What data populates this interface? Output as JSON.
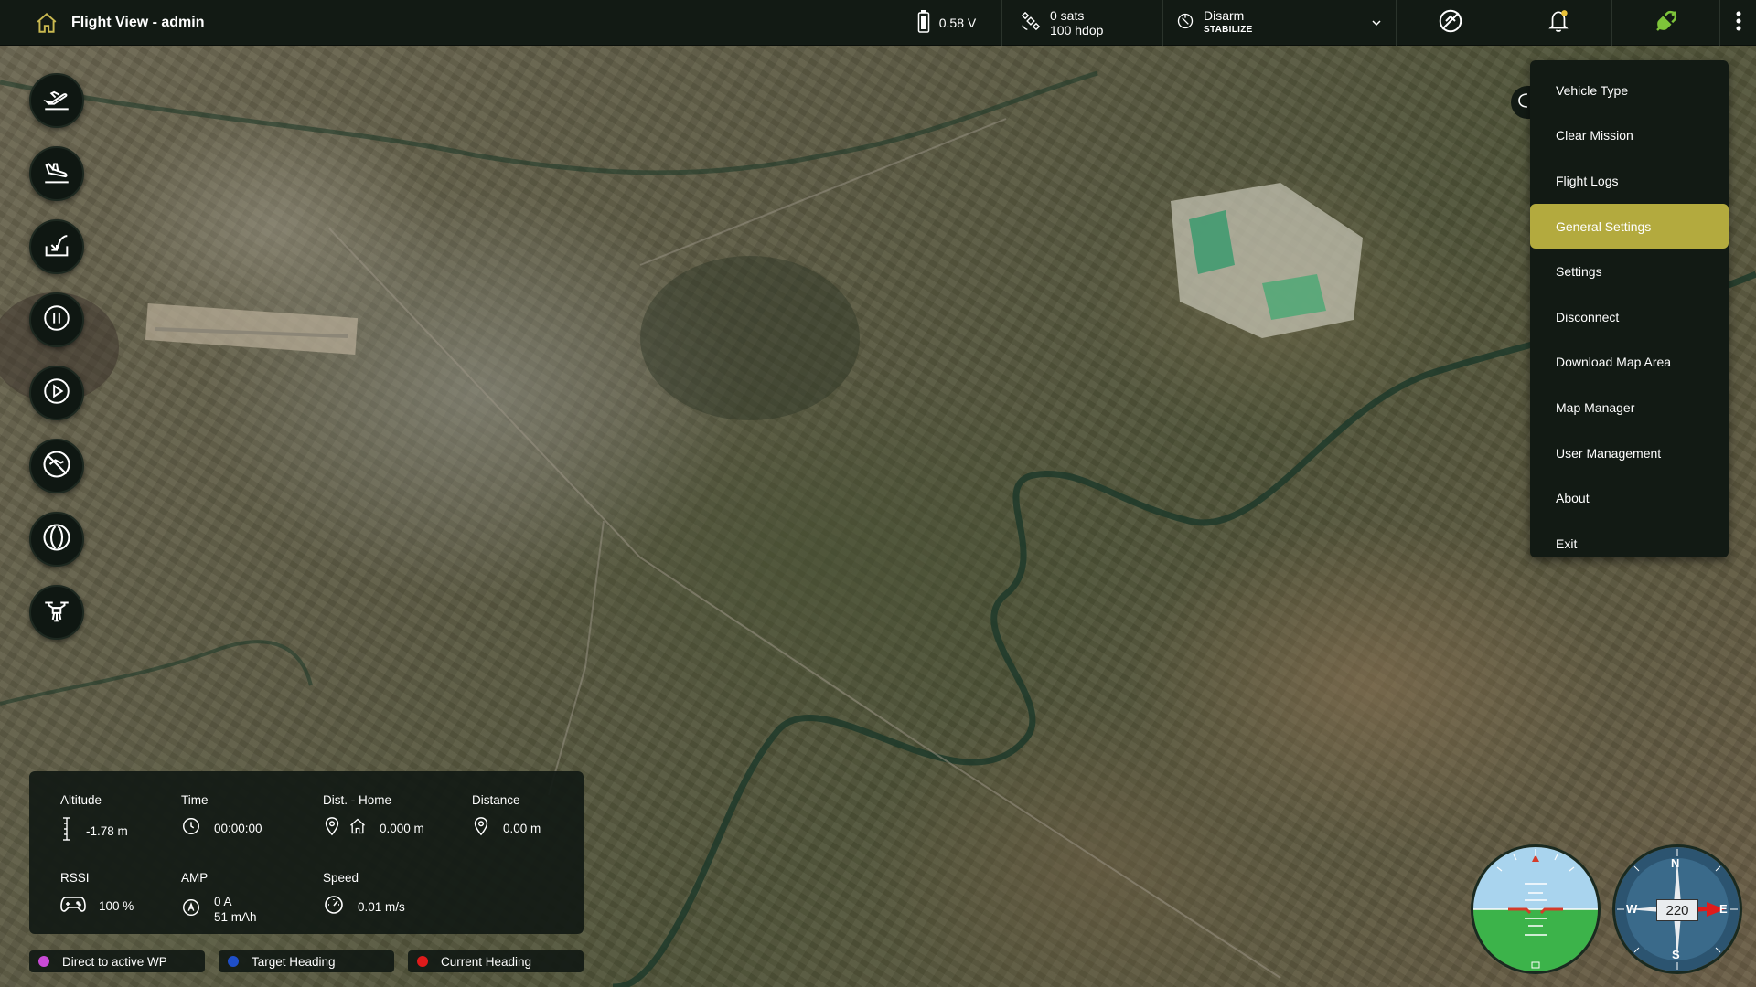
{
  "header": {
    "title": "Flight View - admin",
    "battery": "0.58 V",
    "gps_sats": "0 sats",
    "gps_hdop": "100 hdop",
    "arm_state": "Disarm",
    "flight_mode": "STABILIZE",
    "link_color": "#7ec43a"
  },
  "tools": [
    {
      "name": "takeoff",
      "icon": "takeoff-icon"
    },
    {
      "name": "land",
      "icon": "land-icon"
    },
    {
      "name": "return-to-launch",
      "icon": "rtl-icon"
    },
    {
      "name": "pause",
      "icon": "pause-icon"
    },
    {
      "name": "play",
      "icon": "play-icon"
    },
    {
      "name": "no-fly",
      "icon": "no-fly-icon"
    },
    {
      "name": "orbit",
      "icon": "orbit-icon"
    },
    {
      "name": "drone",
      "icon": "drone-icon"
    }
  ],
  "menu": {
    "items": [
      "Vehicle Type",
      "Clear Mission",
      "Flight Logs",
      "General Settings",
      "Settings",
      "Disconnect",
      "Download Map Area",
      "Map Manager",
      "User Management",
      "About",
      "Exit"
    ],
    "active": "General Settings",
    "accent": "#b3aa3e"
  },
  "telemetry": {
    "altitude_label": "Altitude",
    "altitude_value": "-1.78 m",
    "time_label": "Time",
    "time_value": "00:00:00",
    "dist_home_label": "Dist. - Home",
    "dist_home_value": "0.000 m",
    "distance_label": "Distance",
    "distance_value": "0.00 m",
    "rssi_label": "RSSI",
    "rssi_value": "100 %",
    "amp_label": "AMP",
    "amp_value_a": "0 A",
    "amp_value_mah": "51 mAh",
    "speed_label": "Speed",
    "speed_value": "0.01 m/s"
  },
  "legend": [
    {
      "label": "Direct to active WP",
      "color": "#c94ad6"
    },
    {
      "label": "Target Heading",
      "color": "#1f4fc9"
    },
    {
      "label": "Current Heading",
      "color": "#e01b1b"
    }
  ],
  "compass": {
    "heading": "220",
    "n": "N",
    "s": "S",
    "e": "E",
    "w": "W"
  }
}
